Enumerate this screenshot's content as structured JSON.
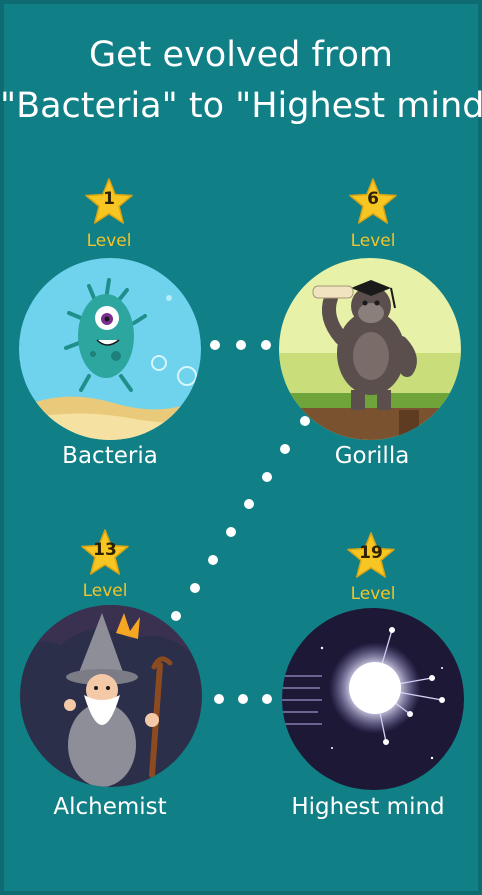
{
  "headline": {
    "line1": "Get evolved from",
    "line2": "\"Bacteria\" to \"Highest mind\""
  },
  "stages": [
    {
      "level": "1",
      "level_label": "Level",
      "name": "Bacteria"
    },
    {
      "level": "6",
      "level_label": "Level",
      "name": "Gorilla"
    },
    {
      "level": "13",
      "level_label": "Level",
      "name": "Alchemist"
    },
    {
      "level": "19",
      "level_label": "Level",
      "name": "Highest mind"
    }
  ],
  "colors": {
    "background": "#117f86",
    "level_text": "#f2c42b",
    "star": "#f7c623"
  }
}
